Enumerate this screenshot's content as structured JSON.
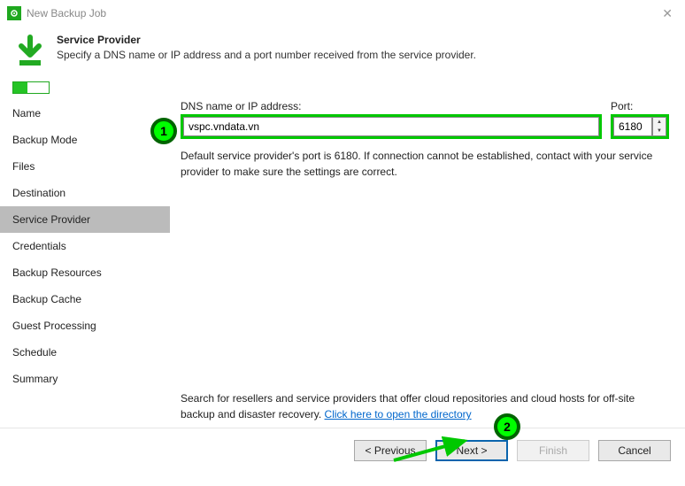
{
  "window": {
    "title": "New Backup Job"
  },
  "header": {
    "title": "Service Provider",
    "subtitle": "Specify a DNS name or IP address and a port number received from the service provider."
  },
  "sidebar": {
    "items": [
      {
        "label": "Name"
      },
      {
        "label": "Backup Mode"
      },
      {
        "label": "Files"
      },
      {
        "label": "Destination"
      },
      {
        "label": "Service Provider"
      },
      {
        "label": "Credentials"
      },
      {
        "label": "Backup Resources"
      },
      {
        "label": "Backup Cache"
      },
      {
        "label": "Guest Processing"
      },
      {
        "label": "Schedule"
      },
      {
        "label": "Summary"
      }
    ],
    "activeIndex": 4
  },
  "fields": {
    "dns_label": "DNS name or IP address:",
    "dns_value": "vspc.vndata.vn",
    "port_label": "Port:",
    "port_value": "6180",
    "hint": "Default service provider's port is 6180. If connection cannot be established, contact with your service provider to make sure the settings are correct."
  },
  "search": {
    "prefix": "Search for resellers and service providers that offer cloud repositories and cloud hosts for off-site backup and disaster recovery. ",
    "link": "Click here to open the directory"
  },
  "buttons": {
    "previous": "< Previous",
    "next": "Next >",
    "finish": "Finish",
    "cancel": "Cancel"
  },
  "annotations": {
    "n1": "1",
    "n2": "2"
  }
}
